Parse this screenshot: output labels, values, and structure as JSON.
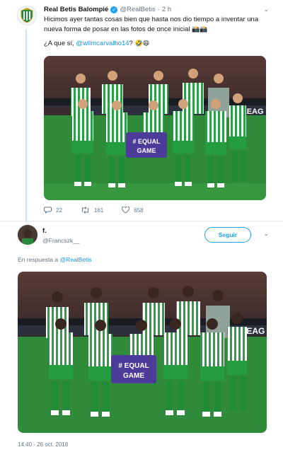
{
  "tweet": {
    "author_name": "Real Betis Balompié",
    "author_handle": "@RealBetis",
    "separator": "·",
    "age": "2 h",
    "text_line1": "Hicimos ayer tantas cosas bien que hasta nos dio tiempo a inventar una nueva forma de posar en las fotos de once inicial",
    "text_q": "¿A que sí, ",
    "mention": "@wllmcarvalho14",
    "text_q_end": "?",
    "image_banner": "#EQUAL GAME",
    "image_banner_line1": "# EQUAL",
    "image_banner_line2": "GAME",
    "image_board_text": "LEAG",
    "stats": {
      "replies": "22",
      "retweets": "161",
      "likes": "658"
    }
  },
  "reply": {
    "author_name": "f.",
    "author_handle": "@Francszk__",
    "follow_label": "Seguir",
    "reply_to_prefix": "En respuesta a ",
    "reply_to_handle": "@RealBetis",
    "image_banner_line1": "# EQUAL",
    "image_banner_line2": "GAME",
    "image_board_text": "LEAG",
    "timestamp": "14:40 - 26 oct. 2018"
  },
  "icons": {
    "verified": "verified-badge-icon",
    "reply": "reply-icon",
    "retweet": "retweet-icon",
    "like": "heart-icon",
    "more": "chevron-down-icon"
  },
  "colors": {
    "accent": "#1da1f2",
    "link": "#1b95e0",
    "muted": "#657786",
    "kit_green": "#2d9d4a",
    "thread_line": "#cfe3f2"
  }
}
